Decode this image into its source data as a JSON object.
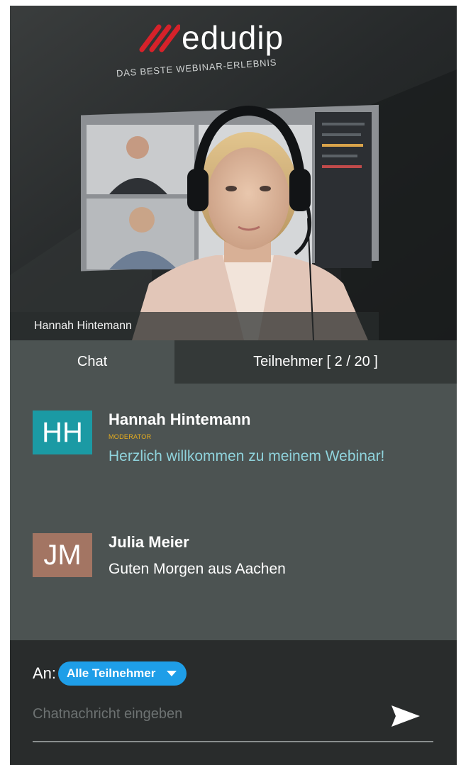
{
  "video": {
    "brand": "edudip",
    "tagline": "DAS BESTE WEBINAR-ERLEBNIS",
    "presenter_name": "Hannah Hintemann"
  },
  "tabs": {
    "chat": "Chat",
    "participants": "Teilnehmer [ 2 / 20 ]"
  },
  "messages": [
    {
      "initials": "HH",
      "avatar_color": "#1b9aa4",
      "author": "Hannah Hintemann",
      "role": "MODERATOR",
      "text": "Herzlich willkommen zu meinem Webinar!",
      "text_color": "#8fd3dc"
    },
    {
      "initials": "JM",
      "avatar_color": "#a37563",
      "author": "Julia Meier",
      "text": "Guten Morgen aus Aachen",
      "text_color": "#ffffff"
    }
  ],
  "composer": {
    "recipient_label": "An:",
    "recipient_value": "Alle Teilnehmer",
    "placeholder": "Chatnachricht eingeben",
    "send_icon": "send-icon"
  },
  "colors": {
    "accent": "#1e9ee8",
    "moderator": "#e8ae1d",
    "panel": "#4c5352"
  }
}
